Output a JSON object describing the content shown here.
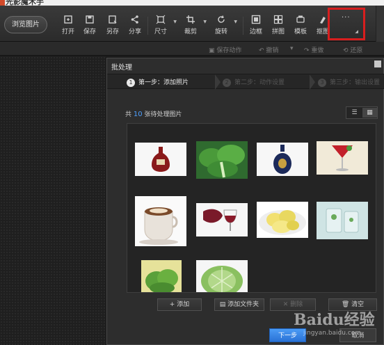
{
  "app": {
    "title": "光影魔术手"
  },
  "toolbar": {
    "browse_label": "浏览图片",
    "tools": [
      {
        "label": "打开",
        "icon": "open-icon"
      },
      {
        "label": "保存",
        "icon": "save-icon"
      },
      {
        "label": "另存",
        "icon": "save-as-icon"
      },
      {
        "label": "分享",
        "icon": "share-icon"
      },
      {
        "label": "尺寸",
        "icon": "resize-icon"
      },
      {
        "label": "裁剪",
        "icon": "crop-icon"
      },
      {
        "label": "旋转",
        "icon": "rotate-icon"
      },
      {
        "label": "边框",
        "icon": "border-icon"
      },
      {
        "label": "拼图",
        "icon": "collage-icon"
      },
      {
        "label": "模板",
        "icon": "template-icon"
      },
      {
        "label": "抠图",
        "icon": "cutout-icon"
      }
    ],
    "more_label": "···"
  },
  "subbar": {
    "save_action": "保存动作",
    "undo": "撤销",
    "redo": "重做",
    "restore": "还原"
  },
  "dialog": {
    "title": "批处理",
    "steps": [
      {
        "num": "1",
        "label": "第一步：添加照片"
      },
      {
        "num": "2",
        "label": "第二步：动作设置"
      },
      {
        "num": "3",
        "label": "第三步：输出设置"
      }
    ],
    "count_prefix": "共",
    "count": "10",
    "count_suffix": "张待处理图片",
    "thumbnails": [
      {
        "subject": "cognac bottle",
        "color": "#8a1a1a"
      },
      {
        "subject": "bok choy",
        "color": "#3a8a3a"
      },
      {
        "subject": "blue liquor bottle",
        "color": "#1c2a5a"
      },
      {
        "subject": "red cocktail",
        "color": "#c2202a"
      },
      {
        "subject": "coffee cup",
        "color": "#7a4a2a"
      },
      {
        "subject": "wine glass",
        "color": "#7a1a2a"
      },
      {
        "subject": "apple slices",
        "color": "#e8d860"
      },
      {
        "subject": "water glass",
        "color": "#bcd8d8"
      },
      {
        "subject": "herbs",
        "color": "#6ab040"
      },
      {
        "subject": "cabbage",
        "color": "#8ac060"
      }
    ],
    "actions": {
      "add": "添加",
      "add_folder": "添加文件夹",
      "delete": "删除",
      "clear": "清空"
    },
    "next": "下一步",
    "cancel": "取消"
  },
  "watermark": {
    "main": "Baidu经验",
    "sub": "jingyan.baidu.com"
  }
}
